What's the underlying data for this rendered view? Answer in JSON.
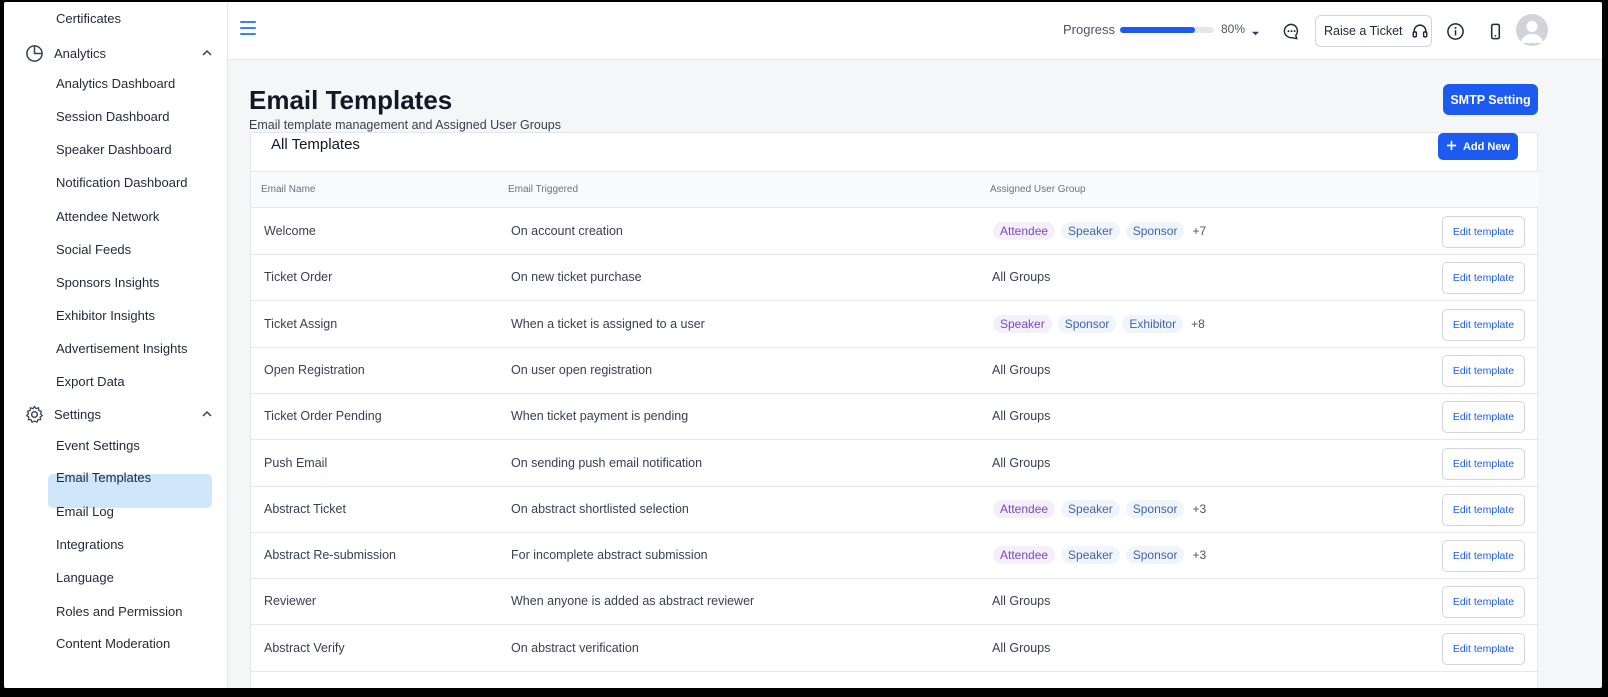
{
  "sidebar": {
    "top_item": "Certificates",
    "analytics": {
      "label": "Analytics",
      "items": [
        "Analytics Dashboard",
        "Session Dashboard",
        "Speaker Dashboard",
        "Notification Dashboard",
        "Attendee Network",
        "Social Feeds",
        "Sponsors Insights",
        "Exhibitor Insights",
        "Advertisement Insights",
        "Export Data"
      ]
    },
    "settings": {
      "label": "Settings",
      "items": [
        "Event Settings",
        "Email Templates",
        "Email Log",
        "Integrations",
        "Language",
        "Roles and Permission",
        "Content Moderation"
      ],
      "active": "Email Templates"
    }
  },
  "topbar": {
    "progress_label": "Progress",
    "progress_value": 0.8,
    "progress_text": "80%",
    "raise_ticket_label": "Raise a Ticket",
    "icons": [
      "menu-icon",
      "chat-icon",
      "headset-icon",
      "info-icon",
      "mobile-icon",
      "user-avatar"
    ]
  },
  "page": {
    "title": "Email Templates",
    "subtitle": "Email template management and Assigned User Groups",
    "smtp_label": "SMTP Setting"
  },
  "card": {
    "title": "All Templates",
    "add_label": "Add New",
    "columns": [
      "Email Name",
      "Email Triggered",
      "Assigned User Group"
    ],
    "edit_label": "Edit template",
    "rows": [
      {
        "name": "Welcome",
        "trigger": "On account creation",
        "groups": [
          "Attendee",
          "Speaker",
          "Sponsor"
        ],
        "more": "+7"
      },
      {
        "name": "Ticket Order",
        "trigger": "On new ticket purchase",
        "groups_text": "All Groups"
      },
      {
        "name": "Ticket Assign",
        "trigger": "When a ticket is assigned to a user",
        "groups": [
          "Speaker",
          "Sponsor",
          "Exhibitor"
        ],
        "more": "+8"
      },
      {
        "name": "Open Registration",
        "trigger": "On user open registration",
        "groups_text": "All Groups"
      },
      {
        "name": "Ticket Order Pending",
        "trigger": "When ticket payment is pending",
        "groups_text": "All Groups"
      },
      {
        "name": "Push Email",
        "trigger": "On sending push email notification",
        "groups_text": "All Groups"
      },
      {
        "name": "Abstract Ticket",
        "trigger": "On abstract shortlisted selection",
        "groups": [
          "Attendee",
          "Speaker",
          "Sponsor"
        ],
        "more": "+3"
      },
      {
        "name": "Abstract Re-submission",
        "trigger": "For incomplete abstract submission",
        "groups": [
          "Attendee",
          "Speaker",
          "Sponsor"
        ],
        "more": "+3"
      },
      {
        "name": "Reviewer",
        "trigger": "When anyone is added as abstract reviewer",
        "groups_text": "All Groups"
      },
      {
        "name": "Abstract Verify",
        "trigger": "On abstract verification",
        "groups_text": "All Groups"
      }
    ]
  },
  "colors": {
    "accent": "#1d5bf0",
    "active_bg": "#cfe6fb",
    "tag_purple": "#7a48c9",
    "tag_blue": "#4262ad"
  }
}
